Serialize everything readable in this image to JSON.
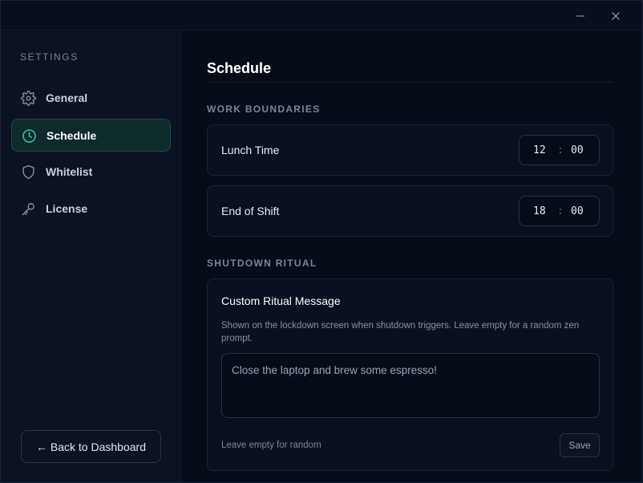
{
  "window": {
    "minimize_glyph": "—",
    "close_glyph": "✕"
  },
  "sidebar": {
    "heading": "SETTINGS",
    "items": [
      {
        "label": "General",
        "icon": "gear-icon",
        "active": false
      },
      {
        "label": "Schedule",
        "icon": "clock-icon",
        "active": true
      },
      {
        "label": "Whitelist",
        "icon": "shield-icon",
        "active": false
      },
      {
        "label": "License",
        "icon": "key-icon",
        "active": false
      }
    ],
    "back_label": "← Back to Dashboard"
  },
  "main": {
    "title": "Schedule",
    "work_section": "WORK BOUNDARIES",
    "lunch": {
      "label": "Lunch Time",
      "hour": "12",
      "minute": "00",
      "separator": ":"
    },
    "shift_end": {
      "label": "End of Shift",
      "hour": "18",
      "minute": "00",
      "separator": ":"
    },
    "ritual_section": "SHUTDOWN RITUAL",
    "ritual": {
      "title": "Custom Ritual Message",
      "help": "Shown on the lockdown screen when shutdown triggers. Leave empty for a random zen prompt.",
      "placeholder": "Close the laptop and brew some espresso!",
      "value": "",
      "footer": "Leave empty for random",
      "save_label": "Save"
    }
  },
  "colors": {
    "accent": "#2fc4a8",
    "active_bg": "#0f2a2a",
    "background": "#070c19"
  }
}
